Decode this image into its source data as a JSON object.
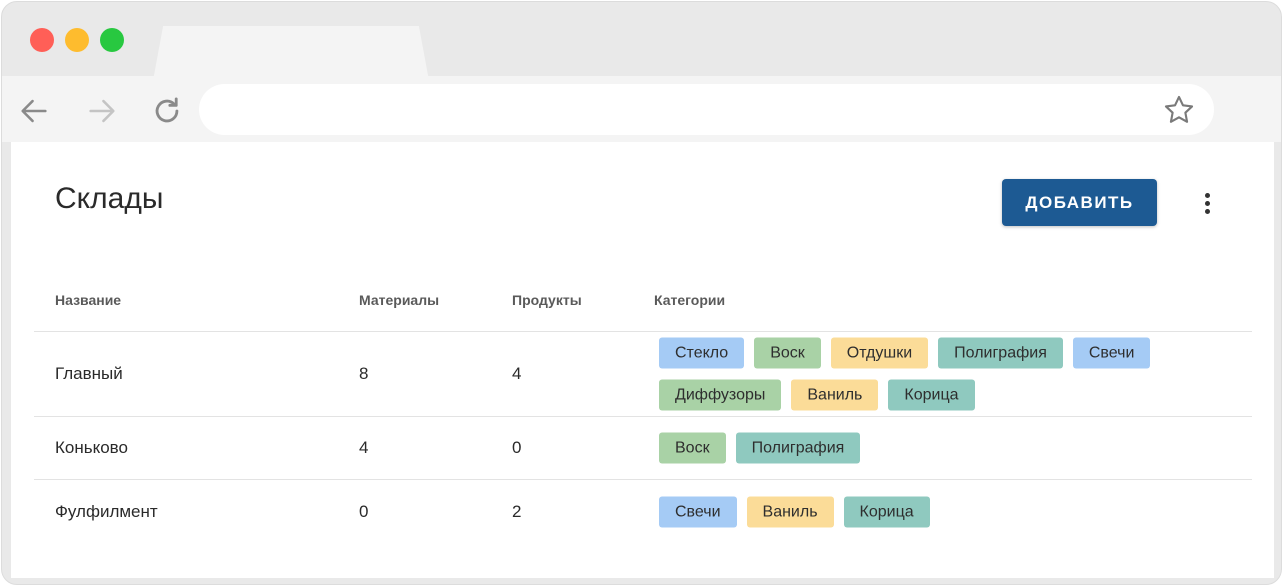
{
  "page": {
    "title": "Склады",
    "add_button_label": "ДОБАВИТЬ"
  },
  "browser": {
    "address_value": "",
    "icons": [
      "back-arrow-icon",
      "forward-arrow-icon",
      "reload-icon",
      "star-icon"
    ]
  },
  "colors": {
    "primary": "#1d5a93",
    "tag_blue": "#a5cbf5",
    "tag_green": "#a9d2a6",
    "tag_yellow": "#fbdc98",
    "tag_teal": "#8fc9bf"
  },
  "table": {
    "headers": {
      "name": "Название",
      "materials": "Материалы",
      "products": "Продукты",
      "categories": "Категории"
    },
    "rows": [
      {
        "name": "Главный",
        "materials": "8",
        "products": "4",
        "categories": [
          {
            "label": "Стекло",
            "color": "blue"
          },
          {
            "label": "Воск",
            "color": "green"
          },
          {
            "label": "Отдушки",
            "color": "yellow"
          },
          {
            "label": "Полиграфия",
            "color": "teal"
          },
          {
            "label": "Свечи",
            "color": "blue"
          },
          {
            "label": "Диффузоры",
            "color": "green"
          },
          {
            "label": "Ваниль",
            "color": "yellow"
          },
          {
            "label": "Корица",
            "color": "teal"
          }
        ]
      },
      {
        "name": "Коньково",
        "materials": "4",
        "products": "0",
        "categories": [
          {
            "label": "Воск",
            "color": "green"
          },
          {
            "label": "Полиграфия",
            "color": "teal"
          }
        ]
      },
      {
        "name": "Фулфилмент",
        "materials": "0",
        "products": "2",
        "categories": [
          {
            "label": "Свечи",
            "color": "blue"
          },
          {
            "label": "Ваниль",
            "color": "yellow"
          },
          {
            "label": "Корица",
            "color": "teal"
          }
        ]
      }
    ]
  }
}
